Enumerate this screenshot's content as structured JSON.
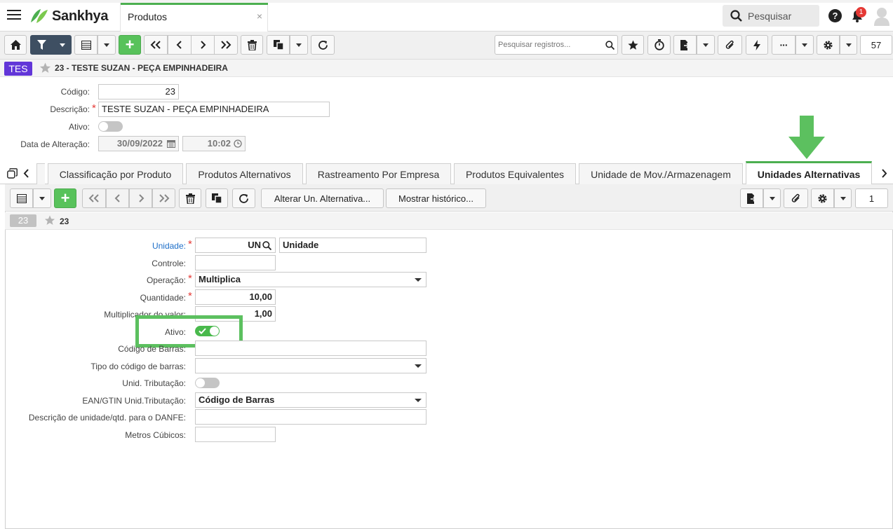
{
  "app": {
    "brand": "Sankhya",
    "tab_title": "Produtos",
    "tab_close": "×",
    "search_placeholder": "Pesquisar",
    "notification_count": "1"
  },
  "toolbar": {
    "search_records_placeholder": "Pesquisar registros...",
    "record_count": "57"
  },
  "breadcrumb": {
    "badge": "TES",
    "title": "23 - TESTE SUZAN - PEÇA EMPINHADEIRA"
  },
  "form": {
    "codigo_label": "Código:",
    "codigo_value": "23",
    "descricao_label": "Descrição:",
    "descricao_value": "TESTE SUZAN - PEÇA EMPINHADEIRA",
    "ativo_label": "Ativo:",
    "ativo_on": false,
    "data_label": "Data de Alteração:",
    "data_value": "30/09/2022",
    "hora_value": "10:02"
  },
  "tabs": [
    {
      "label": "Classificação por Produto"
    },
    {
      "label": "Produtos Alternativos"
    },
    {
      "label": "Rastreamento Por Empresa"
    },
    {
      "label": "Produtos Equivalentes"
    },
    {
      "label": "Unidade de Mov./Armazenagem"
    },
    {
      "label": "Unidades Alternativas",
      "active": true
    }
  ],
  "subtoolbar": {
    "alterar_label": "Alterar Un. Alternativa...",
    "historico_label": "Mostrar histórico...",
    "page": "1"
  },
  "subbreadcrumb": {
    "badge": "23",
    "title": "23"
  },
  "detail": {
    "unidade_label": "Unidade:",
    "unidade_code": "UN",
    "unidade_desc": "Unidade",
    "controle_label": "Controle:",
    "controle_value": "",
    "operacao_label": "Operação:",
    "operacao_value": "Multiplica",
    "quantidade_label": "Quantidade:",
    "quantidade_value": "10,00",
    "multiplicador_label": "Multiplicador do valor:",
    "multiplicador_value": "1,00",
    "ativo_label": "Ativo:",
    "ativo_on": true,
    "codbarras_label": "Código de Barras:",
    "codbarras_value": "",
    "tipocod_label": "Tipo do código de barras:",
    "tipocod_value": "",
    "unidtrib_label": "Unid. Tributação:",
    "unidtrib_on": false,
    "ean_label": "EAN/GTIN Unid.Tributação:",
    "ean_value": "Código de Barras",
    "danfe_label": "Descrição de unidade/qtd. para o DANFE:",
    "danfe_value": "",
    "metros_label": "Metros Cúbicos:",
    "metros_value": ""
  },
  "colors": {
    "accent_green": "#4caf50",
    "highlight_green": "#5cc05f",
    "badge_purple": "#6236d8",
    "required_red": "#e53935",
    "link_blue": "#1e6fc8"
  }
}
